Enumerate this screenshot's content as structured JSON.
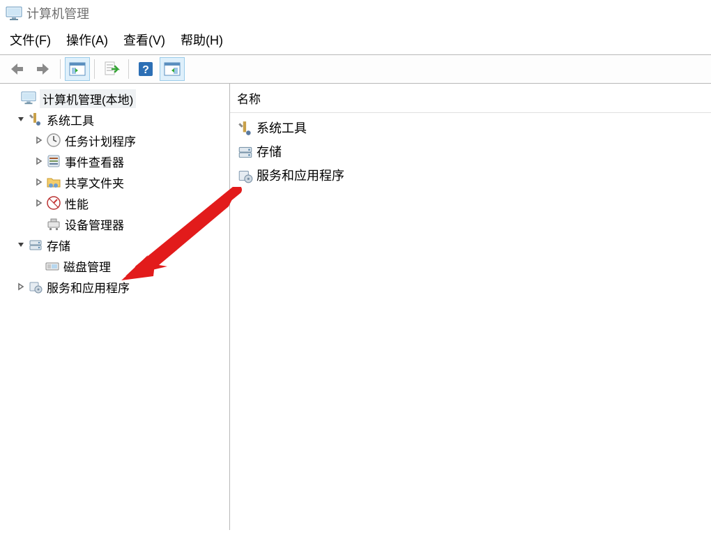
{
  "window": {
    "title": "计算机管理"
  },
  "menubar": {
    "file": "文件(F)",
    "action": "操作(A)",
    "view": "查看(V)",
    "help": "帮助(H)"
  },
  "toolbar_names": {
    "back": "back-icon",
    "forward": "forward-icon",
    "show_hide": "show-hide-pane-icon",
    "export": "export-list-icon",
    "help": "help-icon",
    "actions": "show-actions-pane-icon"
  },
  "tree": {
    "root": {
      "label": "计算机管理(本地)"
    },
    "system_tools": {
      "label": "系统工具"
    },
    "task_scheduler": {
      "label": "任务计划程序"
    },
    "event_viewer": {
      "label": "事件查看器"
    },
    "shared_folders": {
      "label": "共享文件夹"
    },
    "performance": {
      "label": "性能"
    },
    "device_manager": {
      "label": "设备管理器"
    },
    "storage": {
      "label": "存储"
    },
    "disk_management": {
      "label": "磁盘管理"
    },
    "services_apps": {
      "label": "服务和应用程序"
    }
  },
  "list": {
    "column_name": "名称",
    "items": [
      {
        "label": "系统工具"
      },
      {
        "label": "存储"
      },
      {
        "label": "服务和应用程序"
      }
    ]
  }
}
